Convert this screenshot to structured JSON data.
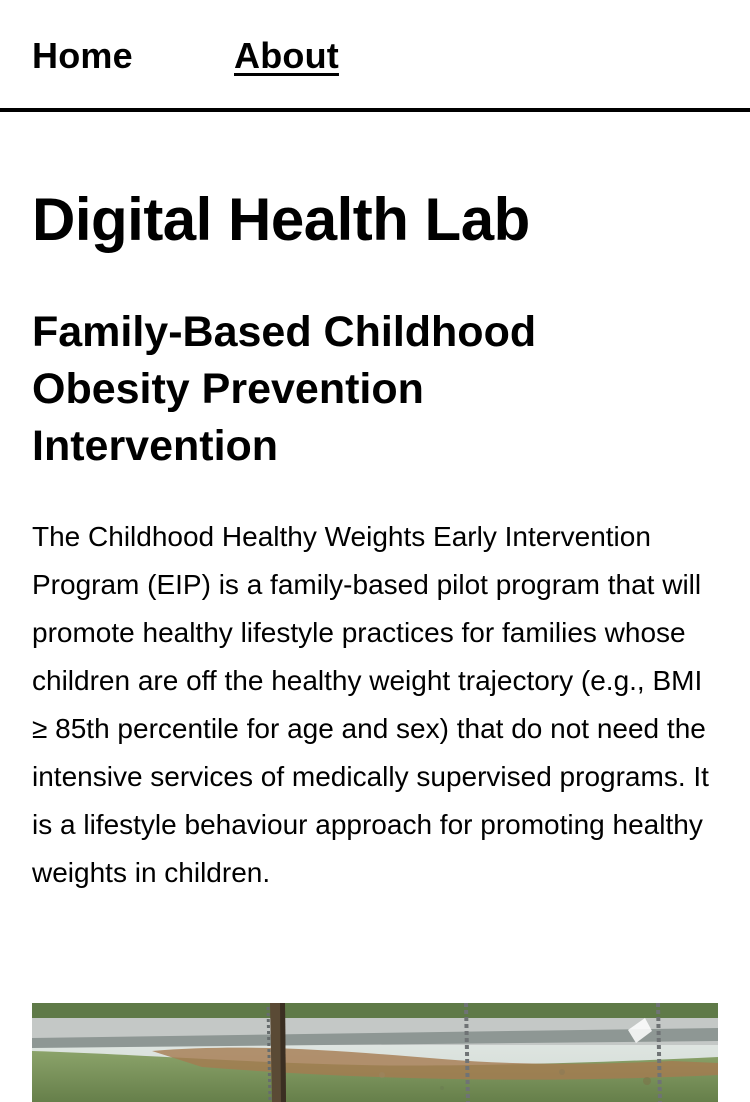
{
  "nav": {
    "home_label": "Home",
    "about_label": "About"
  },
  "site": {
    "title": "Digital Health Lab"
  },
  "project": {
    "title": "Family-Based Childhood Obesity Prevention Intervention",
    "description": "The Childhood Healthy Weights Early Intervention Program (EIP) is a family-based pilot program that will promote healthy lifestyle practices for families whose children are off the healthy weight trajectory (e.g., BMI ≥ 85th percentile for age and sex) that do not need the intensive services of medically supervised programs. It is a lifestyle behaviour approach for promoting healthy weights in children."
  },
  "colors": {
    "text": "#000000",
    "background": "#ffffff",
    "nav_border": "#000000"
  }
}
